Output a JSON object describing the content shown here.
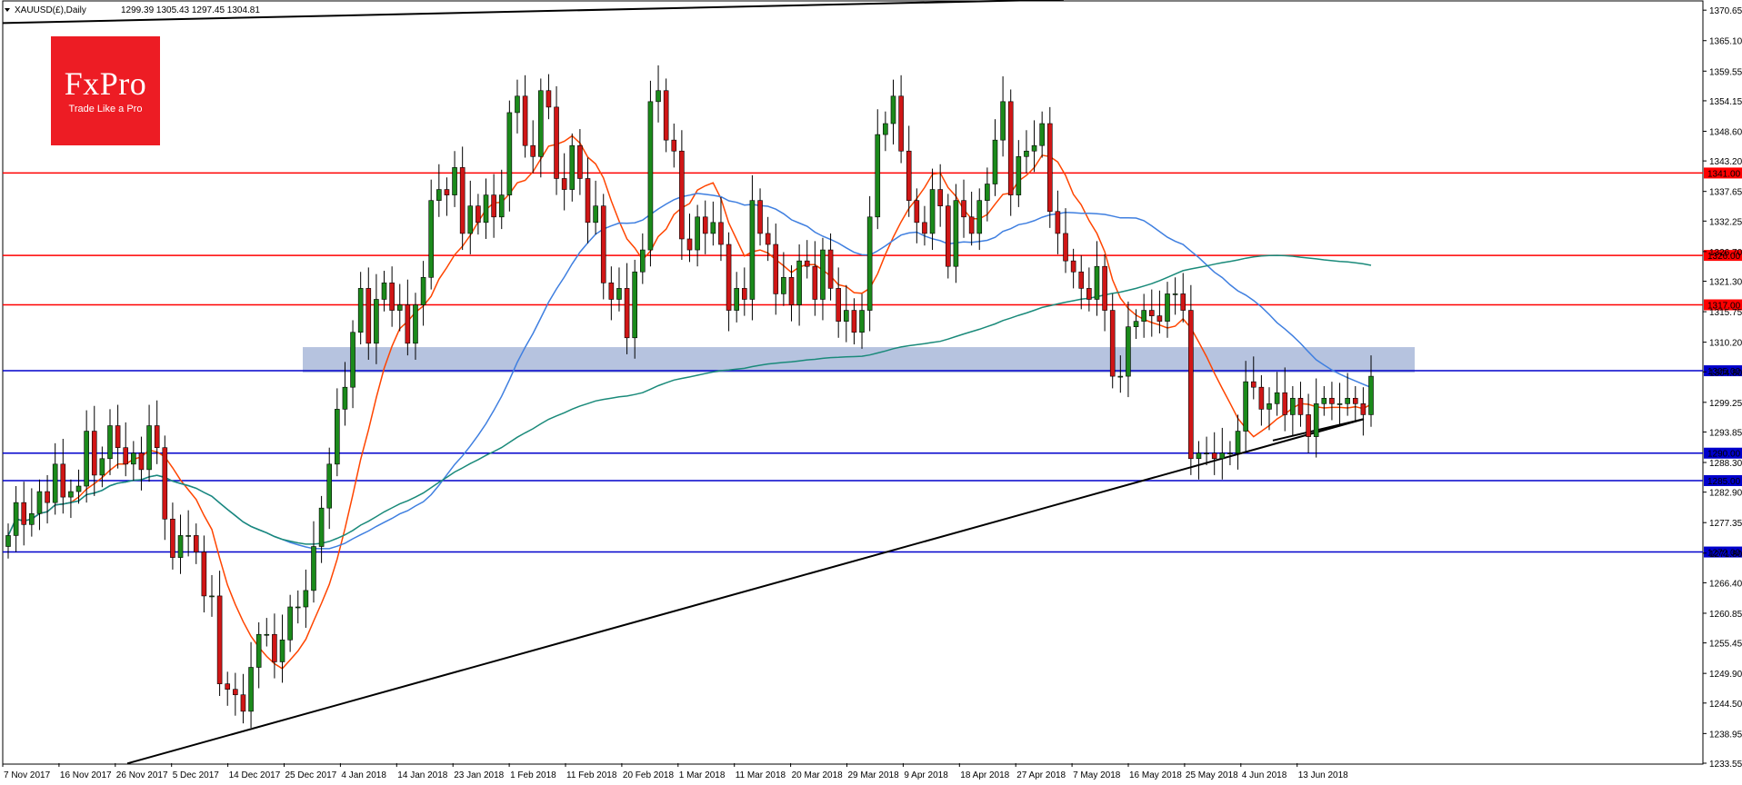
{
  "header": {
    "symbol": "XAUUSD(£),Daily",
    "ohlc": "1299.39 1305.43 1297.45 1304.81"
  },
  "logo": {
    "brand": "FxPro",
    "tagline": "Trade Like a Pro",
    "color": "#ed1c24"
  },
  "chart_data": {
    "type": "candlestick",
    "title": "",
    "xlabel": "",
    "ylabel": "",
    "ylim": [
      1233.55,
      1372.5
    ],
    "y_ticks": [
      "1370.65",
      "1365.10",
      "1359.55",
      "1354.15",
      "1348.60",
      "1343.20",
      "1337.65",
      "1332.25",
      "1326.70",
      "1321.30",
      "1315.75",
      "1310.20",
      "1304.80",
      "1299.25",
      "1293.85",
      "1288.30",
      "1282.90",
      "1277.35",
      "1271.80",
      "1266.40",
      "1260.85",
      "1255.45",
      "1249.90",
      "1244.50",
      "1238.95",
      "1233.55"
    ],
    "x_ticks": [
      "7 Nov 2017",
      "16 Nov 2017",
      "26 Nov 2017",
      "5 Dec 2017",
      "14 Dec 2017",
      "25 Dec 2017",
      "4 Jan 2018",
      "14 Jan 2018",
      "23 Jan 2018",
      "1 Feb 2018",
      "11 Feb 2018",
      "20 Feb 2018",
      "1 Mar 2018",
      "11 Mar 2018",
      "20 Mar 2018",
      "29 Mar 2018",
      "9 Apr 2018",
      "18 Apr 2018",
      "27 Apr 2018",
      "7 May 2018",
      "16 May 2018",
      "25 May 2018",
      "4 Jun 2018",
      "13 Jun 2018"
    ],
    "ohlc_close_approx": [
      1275,
      1281,
      1277,
      1279,
      1283,
      1281,
      1288,
      1282,
      1283,
      1284,
      1294,
      1286,
      1289,
      1295,
      1291,
      1288,
      1290,
      1287,
      1295,
      1291,
      1278,
      1271,
      1275,
      1275,
      1272,
      1264,
      1264,
      1248,
      1247,
      1246,
      1243,
      1251,
      1257,
      1257,
      1252,
      1256,
      1262,
      1262,
      1265,
      1273,
      1280,
      1288,
      1298,
      1302,
      1312,
      1320,
      1310,
      1318,
      1321,
      1316,
      1317,
      1310,
      1317,
      1322,
      1336,
      1338,
      1337,
      1342,
      1330,
      1335,
      1332,
      1337,
      1333,
      1337,
      1352,
      1355,
      1346,
      1344,
      1356,
      1353,
      1340,
      1338,
      1346,
      1340,
      1332,
      1335,
      1321,
      1318,
      1320,
      1311,
      1323,
      1327,
      1354,
      1356,
      1347,
      1345,
      1329,
      1327,
      1333,
      1330,
      1332,
      1328,
      1316,
      1320,
      1318,
      1336,
      1330,
      1328,
      1319,
      1322,
      1317,
      1325,
      1324,
      1318,
      1327,
      1320,
      1314,
      1316,
      1312,
      1316,
      1333,
      1348,
      1350,
      1355,
      1345,
      1336,
      1332,
      1330,
      1338,
      1335,
      1324,
      1336,
      1333,
      1330,
      1336,
      1339,
      1347,
      1354,
      1337,
      1344,
      1345,
      1346,
      1350,
      1334,
      1330,
      1325,
      1323,
      1320,
      1318,
      1324,
      1316,
      1304,
      1304,
      1313,
      1314,
      1316,
      1315,
      1314,
      1319,
      1319,
      1316,
      1289,
      1290,
      1290,
      1289,
      1290,
      1290,
      1294,
      1303,
      1302,
      1298,
      1299,
      1301,
      1297,
      1300,
      1297,
      1293,
      1299,
      1300,
      1299,
      1299,
      1300,
      1299,
      1297,
      1304
    ],
    "horizontal_levels": [
      {
        "value": 1341.0,
        "label": "1341.00",
        "color": "#ff0000"
      },
      {
        "value": 1326.0,
        "label": "1326.00",
        "color": "#ff0000"
      },
      {
        "value": 1317.0,
        "label": "1317.00",
        "color": "#ff0000"
      },
      {
        "value": 1305.0,
        "label": "1305.00",
        "color": "#0000cc"
      },
      {
        "value": 1290.0,
        "label": "1290.00",
        "color": "#0000cc"
      },
      {
        "value": 1285.0,
        "label": "1285.00",
        "color": "#0000cc"
      },
      {
        "value": 1272.0,
        "label": "1272.00",
        "color": "#0000cc"
      }
    ],
    "zone": {
      "low": 1305.0,
      "high": 1307.0,
      "color": "#a9b9d9"
    },
    "trendlines": [
      {
        "color": "#000000"
      },
      {
        "color": "#000000"
      },
      {
        "color": "#000000"
      }
    ],
    "moving_averages": [
      {
        "color": "#ff4500"
      },
      {
        "color": "#3f7fe0"
      },
      {
        "color": "#1a8a7a"
      }
    ],
    "colors": {
      "bull": "#1b8a1b",
      "bear": "#d01616",
      "wick": "#000000",
      "axis": "#000000"
    }
  }
}
